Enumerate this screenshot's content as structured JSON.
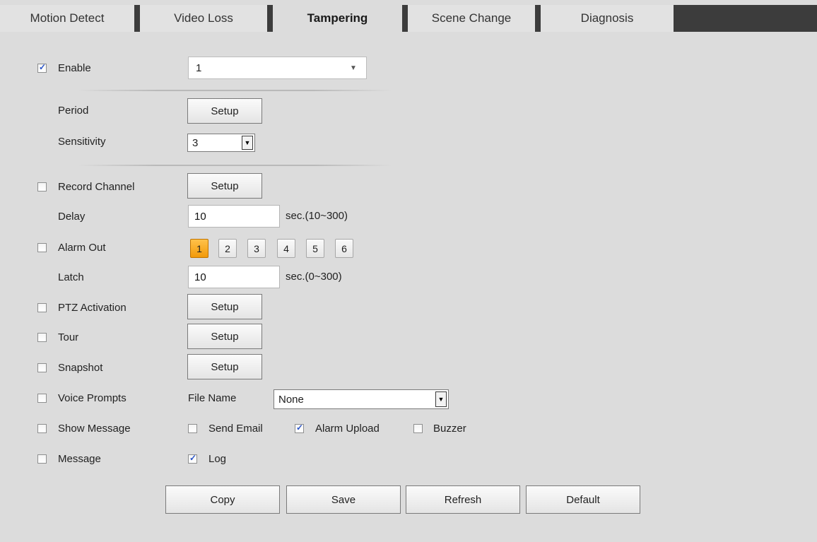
{
  "tabs": [
    {
      "label": "Motion Detect"
    },
    {
      "label": "Video Loss"
    },
    {
      "label": "Tampering",
      "active": true
    },
    {
      "label": "Scene Change"
    },
    {
      "label": "Diagnosis"
    }
  ],
  "enable": {
    "label": "Enable",
    "checked": true,
    "channel_value": "1"
  },
  "period": {
    "label": "Period",
    "button": "Setup"
  },
  "sensitivity": {
    "label": "Sensitivity",
    "value": "3"
  },
  "record_channel": {
    "label": "Record Channel",
    "checked": false,
    "button": "Setup"
  },
  "delay": {
    "label": "Delay",
    "value": "10",
    "unit": "sec.(10~300)"
  },
  "alarm_out": {
    "label": "Alarm Out",
    "checked": false,
    "outputs": [
      "1",
      "2",
      "3",
      "4",
      "5",
      "6"
    ],
    "active_output": "1"
  },
  "latch": {
    "label": "Latch",
    "value": "10",
    "unit": "sec.(0~300)"
  },
  "ptz_activation": {
    "label": "PTZ Activation",
    "checked": false,
    "button": "Setup"
  },
  "tour": {
    "label": "Tour",
    "checked": false,
    "button": "Setup"
  },
  "snapshot": {
    "label": "Snapshot",
    "checked": false,
    "button": "Setup"
  },
  "voice_prompts": {
    "label": "Voice Prompts",
    "checked": false,
    "file_name_label": "File Name",
    "file_name_value": "None"
  },
  "show_message": {
    "label": "Show Message",
    "checked": false
  },
  "send_email": {
    "label": "Send Email",
    "checked": false
  },
  "alarm_upload": {
    "label": "Alarm Upload",
    "checked": true
  },
  "buzzer": {
    "label": "Buzzer",
    "checked": false
  },
  "message": {
    "label": "Message",
    "checked": false
  },
  "log": {
    "label": "Log",
    "checked": true
  },
  "actions": {
    "copy": "Copy",
    "save": "Save",
    "refresh": "Refresh",
    "default": "Default"
  },
  "colors": {
    "background": "#dcdcdc",
    "tab_separator": "#3c3c3c",
    "active_output": "#f5a623",
    "checkmark": "#2b55c8"
  }
}
